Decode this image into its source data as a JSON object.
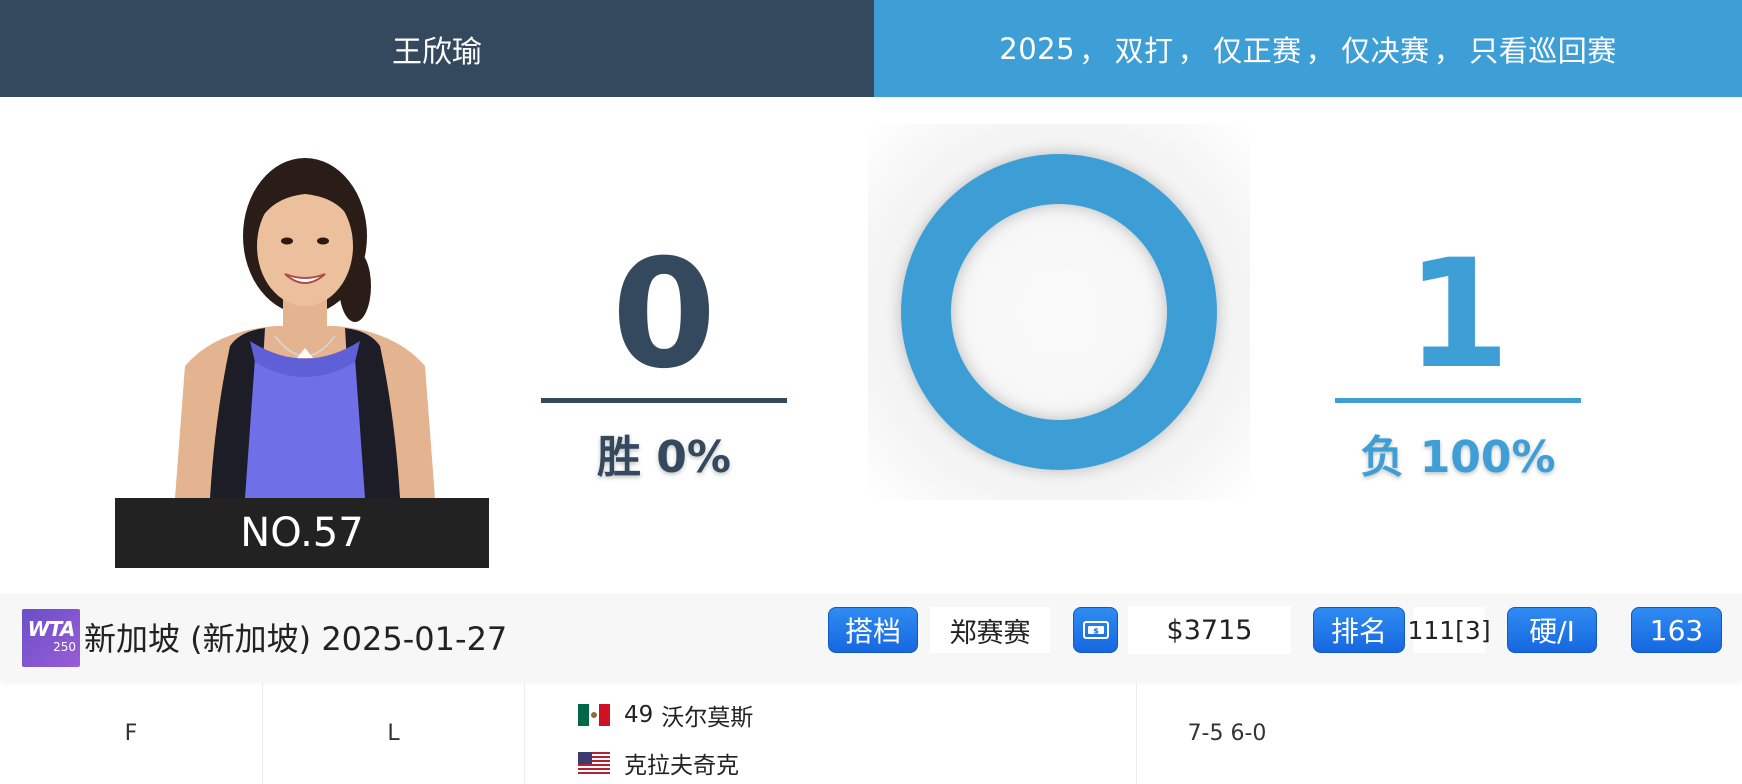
{
  "header": {
    "player_name": "王欣瑜",
    "filters": [
      "2025",
      "双打",
      "仅正赛",
      "仅决赛",
      "只看巡回赛"
    ],
    "filter_separator": "，"
  },
  "player": {
    "rank_label": "NO.57"
  },
  "record": {
    "wins": "0",
    "win_label": "胜 0%",
    "losses": "1",
    "loss_label": "负 100%",
    "win_fraction": 0,
    "loss_fraction": 1,
    "colors": {
      "win": "#34495e",
      "loss": "#3e9ed6"
    }
  },
  "tournament": {
    "logo_text": "WTA",
    "logo_tier": "250",
    "title": "新加坡 (新加坡) 2025-01-27",
    "partner_label": "搭档",
    "partner_name": "郑赛赛",
    "prize_icon": "money-icon",
    "prize_value": "$3715",
    "rank_label": "排名",
    "rank_value": "111[3]",
    "surface_label": "硬/I",
    "points_value": "163"
  },
  "match": {
    "round": "F",
    "result": "L",
    "opponents": [
      {
        "flag": "mexico-flag-icon",
        "seed": "49",
        "name": "沃尔莫斯"
      },
      {
        "flag": "usa-flag-icon",
        "seed": "",
        "name": "克拉夫奇克"
      }
    ],
    "score": "7-5 6-0"
  }
}
